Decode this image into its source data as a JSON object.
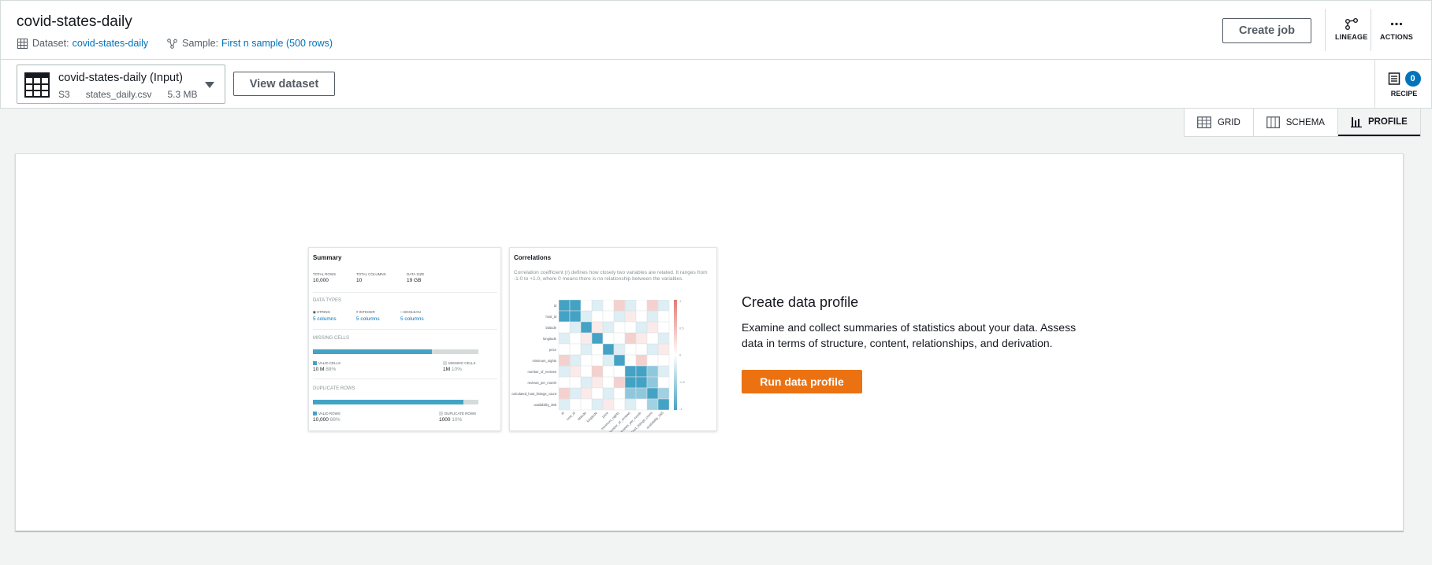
{
  "header": {
    "title": "covid-states-daily",
    "dataset_label": "Dataset:",
    "dataset_name": "covid-states-daily",
    "sample_label": "Sample:",
    "sample_value": "First n sample (500 rows)",
    "create_job_label": "Create job",
    "lineage_label": "LINEAGE",
    "actions_label": "ACTIONS"
  },
  "dataset_bar": {
    "name": "covid-states-daily (Input)",
    "source": "S3",
    "file": "states_daily.csv",
    "size": "5.3 MB",
    "view_dataset_label": "View dataset",
    "recipe_label": "RECIPE",
    "recipe_count": "0"
  },
  "tabs": [
    {
      "label": "GRID",
      "icon": "grid-icon"
    },
    {
      "label": "SCHEMA",
      "icon": "schema-icon"
    },
    {
      "label": "PROFILE",
      "icon": "profile-icon",
      "active": true
    }
  ],
  "preview": {
    "summary": {
      "title": "Summary",
      "total_rows_label": "TOTAL ROWS",
      "total_rows": "10,000",
      "total_columns_label": "TOTAL COLUMNS",
      "total_columns": "10",
      "data_size_label": "DATA SIZE",
      "data_size": "19 GB",
      "data_types_label": "DATA TYPES",
      "types": [
        {
          "label": "STRING",
          "value": "5 columns"
        },
        {
          "label": "INTEGER",
          "value": "5 columns"
        },
        {
          "label": "BOOLEAN",
          "value": "5 columns"
        }
      ],
      "missing_label": "MISSING CELLS",
      "missing_valid_fraction": 0.72,
      "valid_cells_label": "VALID CELLS",
      "valid_cells": "10 M",
      "valid_cells_pct": "88%",
      "missing_cells_label": "MISSING CELLS",
      "missing_cells": "1M",
      "missing_cells_pct": "10%",
      "duplicate_label": "DUPLICATE ROWS",
      "duplicate_valid_fraction": 0.91,
      "dup_valid_label": "VALID ROWS",
      "dup_valid": "10,000",
      "dup_valid_pct": "88%",
      "dup_rows_label": "DUPLICATE ROWS",
      "dup_rows": "1000",
      "dup_rows_pct": "10%"
    },
    "correlations": {
      "title": "Correlations",
      "description": "Correlation coefficient (r) defines how closely two variables are related. It ranges from -1.0 to +1.0, where 0 means there is no relationship between the variables.",
      "variables": [
        "id",
        "host_id",
        "latitude",
        "longitude",
        "price",
        "minimum_nights",
        "number_of_reviews",
        "reviews_per_month",
        "calculated_host_listings_count",
        "availability_365"
      ],
      "scale": [
        "1",
        "0.5",
        "0",
        "-0.5",
        "-1"
      ]
    }
  },
  "cta": {
    "title": "Create data profile",
    "description": "Examine and collect summaries of statistics about your data. Assess data in terms of structure, content, relationships, and derivation.",
    "button_label": "Run data profile"
  },
  "colors": {
    "accent": "#0073bb",
    "primary_button": "#ec7211",
    "heat_positive": "#44a3c5",
    "heat_negative": "#e07b73"
  }
}
